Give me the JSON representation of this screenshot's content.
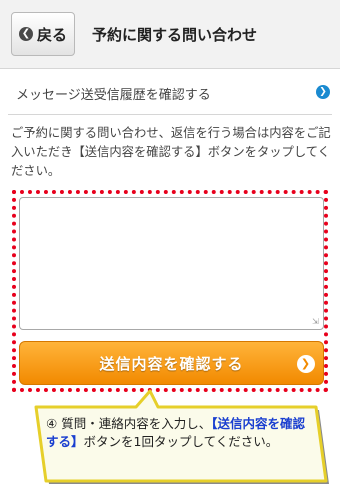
{
  "header": {
    "back_label": "戻る",
    "back_icon": "chevron-left-circle-icon",
    "title": "予約に関する問い合わせ"
  },
  "history_link": {
    "label": "メッセージ送受信履歴を確認する",
    "icon": "chevron-right-circle-icon",
    "icon_color": "#1a8ad0"
  },
  "instructions": "ご予約に関する問い合わせ、返信を行う場合は内容をご記入いただき【送信内容を確認する】ボタンをタップしてください。",
  "message_input": {
    "value": "",
    "placeholder": ""
  },
  "confirm_button": {
    "label": "送信内容を確認する",
    "color": "#f28a00"
  },
  "annotation": {
    "number": "④",
    "part1": "質問・連絡内容を入力し、",
    "highlight": "【送信内容を確認する】",
    "part2": "ボタンを1回タップしてください。",
    "frame_color": "#e8001c",
    "highlight_color": "#1a3fd0"
  }
}
